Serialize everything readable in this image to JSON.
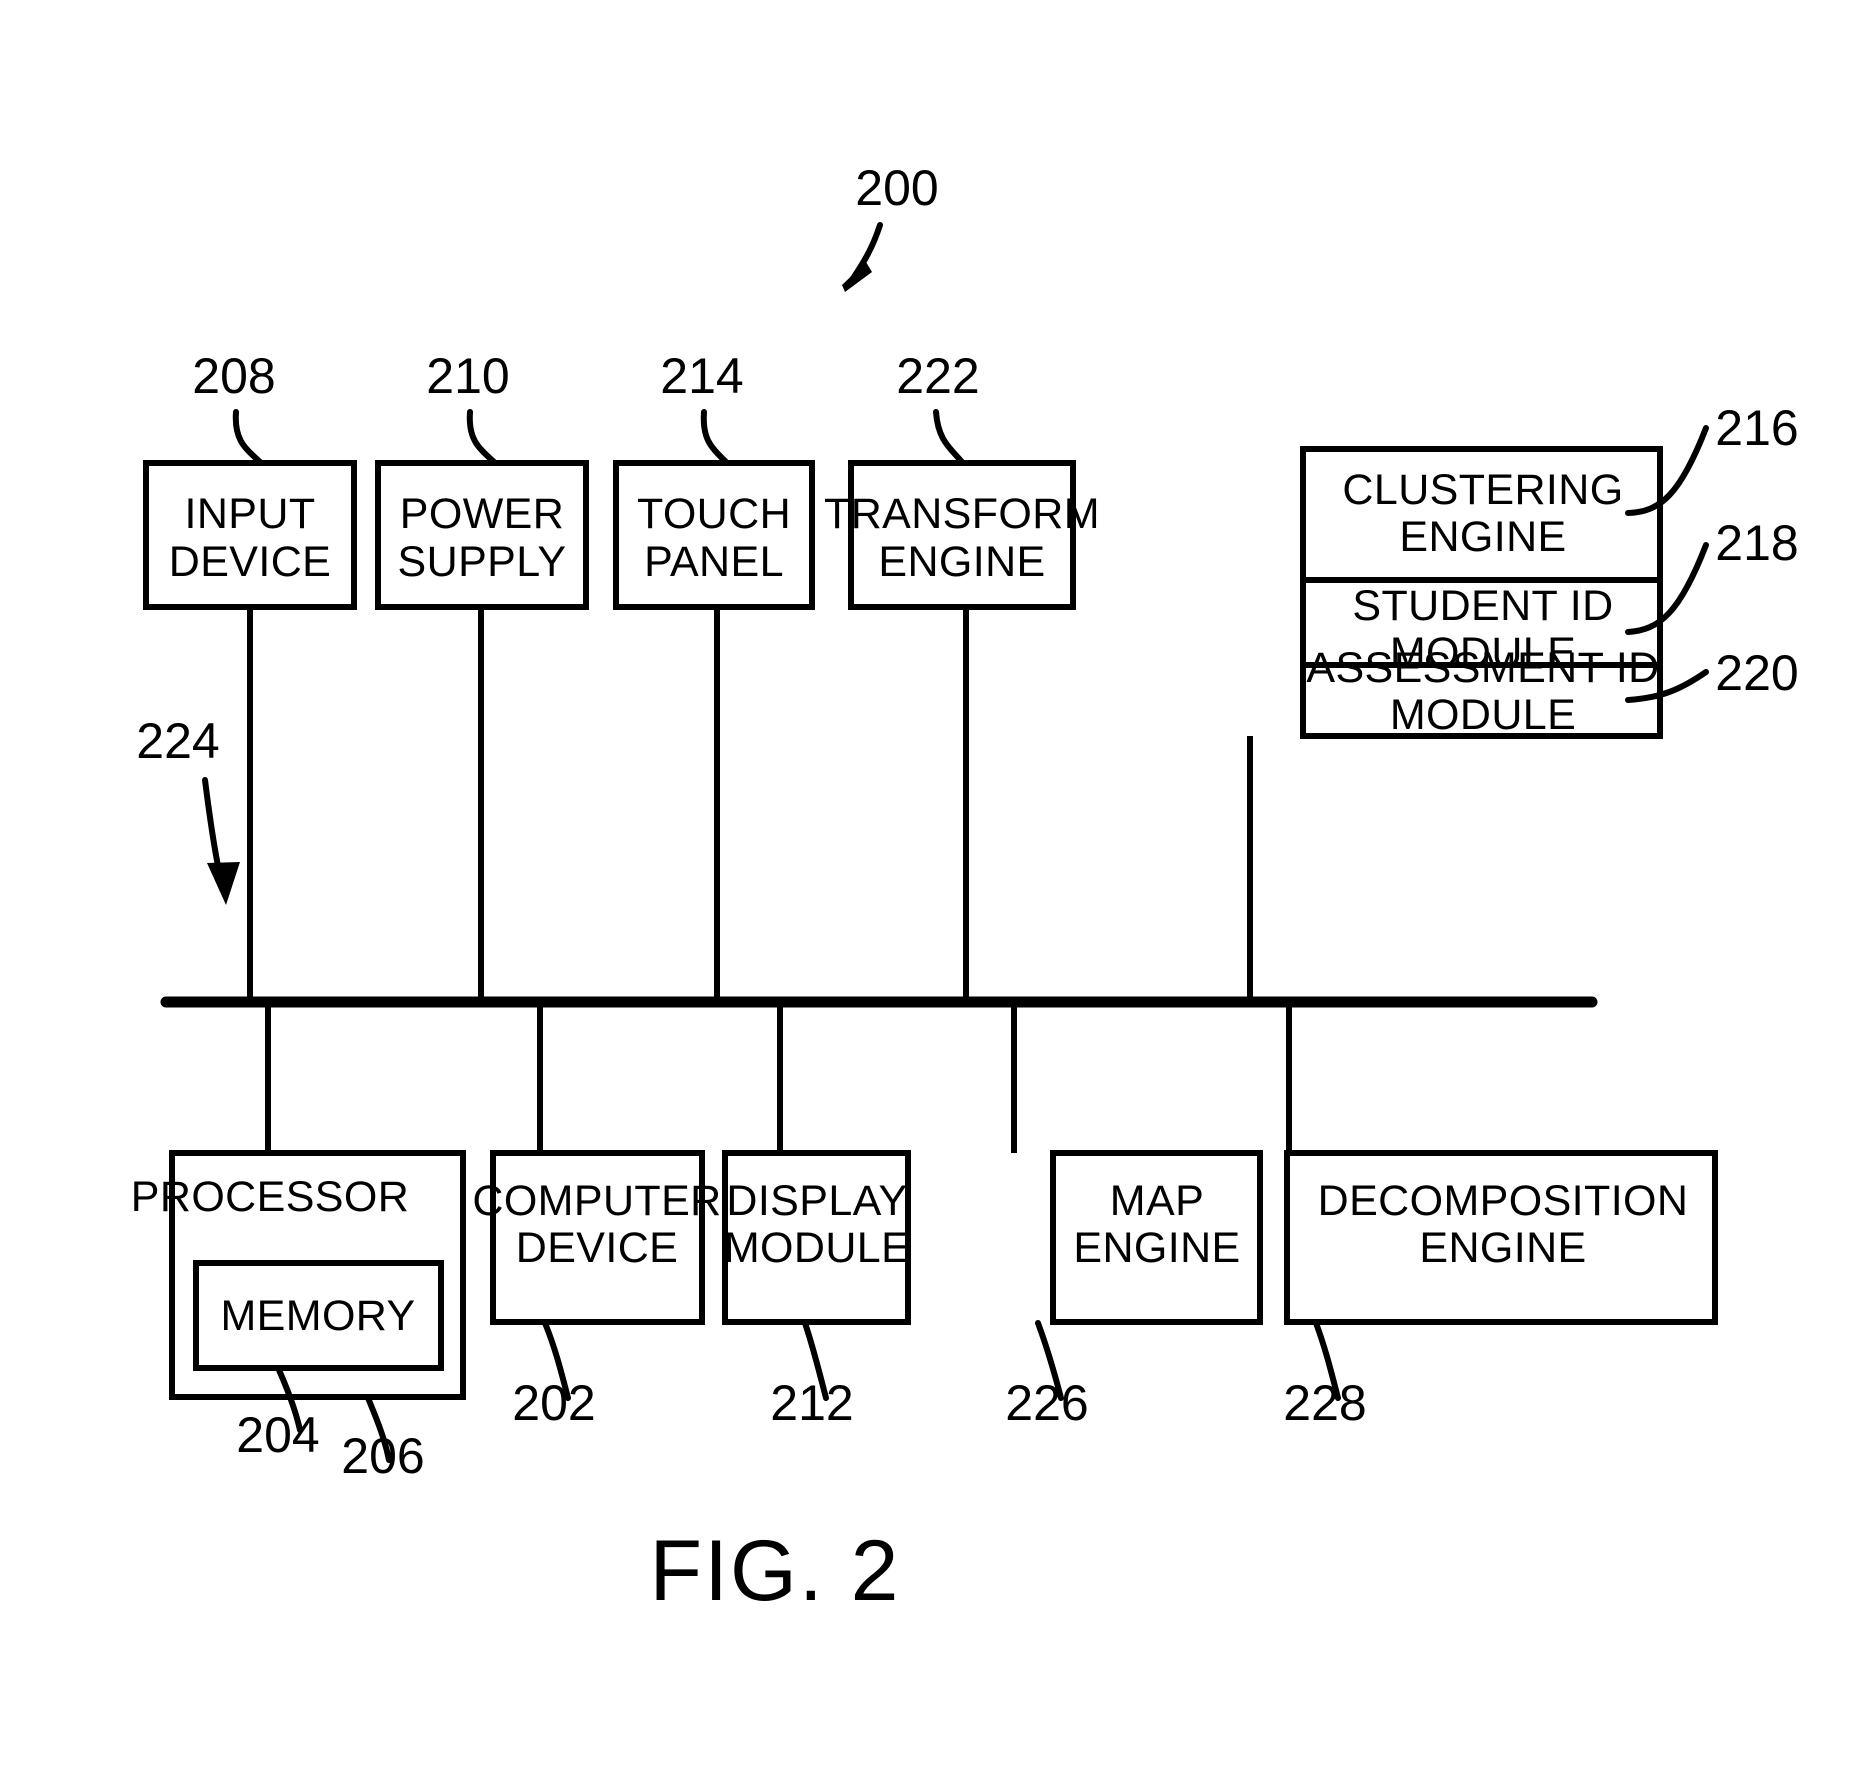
{
  "figure": {
    "caption": "FIG. 2",
    "system_ref": "200",
    "bus_ref": "224"
  },
  "top_row": [
    {
      "ref": "208",
      "line1": "INPUT",
      "line2": "DEVICE"
    },
    {
      "ref": "210",
      "line1": "POWER",
      "line2": "SUPPLY"
    },
    {
      "ref": "214",
      "line1": "TOUCH",
      "line2": "PANEL"
    },
    {
      "ref": "222",
      "line1": "TRANSFORM",
      "line2": "ENGINE"
    }
  ],
  "stack": [
    {
      "ref": "216",
      "line1": "CLUSTERING",
      "line2": "ENGINE"
    },
    {
      "ref": "218",
      "line1": "STUDENT ID",
      "line2": "MODULE"
    },
    {
      "ref": "220",
      "line1": "ASSESSMENT ID",
      "line2": "MODULE"
    }
  ],
  "bottom_row": [
    {
      "ref": "206",
      "line1": "PROCESSOR",
      "line2": ""
    },
    {
      "ref": "202",
      "line1": "COMPUTER",
      "line2": "DEVICE"
    },
    {
      "ref": "212",
      "line1": "DISPLAY",
      "line2": "MODULE"
    },
    {
      "ref": "226",
      "line1": "MAP",
      "line2": "ENGINE"
    },
    {
      "ref": "228",
      "line1": "DECOMPOSITION",
      "line2": "ENGINE"
    }
  ],
  "memory": {
    "ref": "204",
    "label": "MEMORY"
  }
}
